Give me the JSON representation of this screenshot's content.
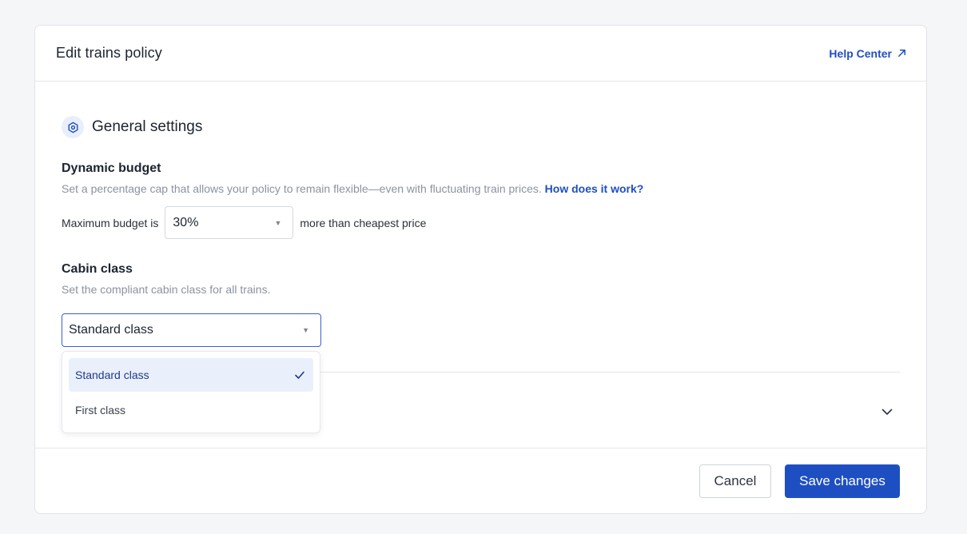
{
  "modal": {
    "title": "Edit trains policy",
    "help_link": "Help Center"
  },
  "general": {
    "title": "General settings",
    "icon": "gear-icon"
  },
  "dynamic_budget": {
    "title": "Dynamic budget",
    "description": "Set a percentage cap that allows your policy to remain flexible—even with fluctuating train prices.",
    "link": "How does it work?",
    "prefix": "Maximum budget is",
    "value": "30%",
    "suffix": "more than cheapest price"
  },
  "cabin_class": {
    "title": "Cabin class",
    "description": "Set the compliant cabin class for all trains.",
    "value": "Standard class",
    "options": [
      {
        "label": "Standard class",
        "selected": true
      },
      {
        "label": "First class",
        "selected": false
      }
    ]
  },
  "footer": {
    "cancel_label": "Cancel",
    "save_label": "Save changes"
  },
  "colors": {
    "accent": "#1e4fc2",
    "selected_bg": "#eaf0fb"
  }
}
